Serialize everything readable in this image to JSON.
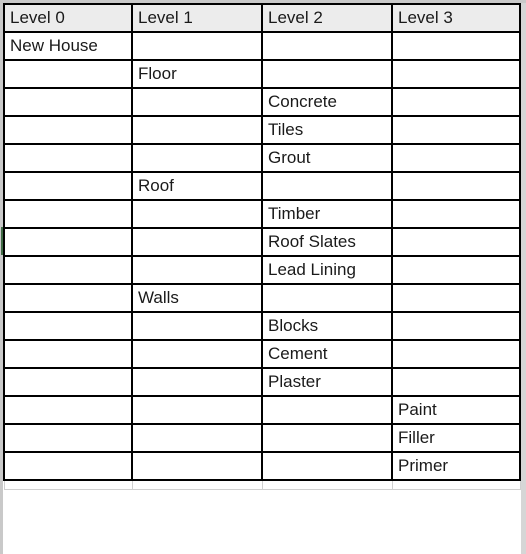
{
  "sheet": {
    "name": "work-breakdown-structure-sheet",
    "header_background": "#ececec",
    "grid_line_color": "#000000",
    "marker_color": "#3f6b45",
    "columns": [
      {
        "key": "level0",
        "label": "Level 0"
      },
      {
        "key": "level1",
        "label": "Level 1"
      },
      {
        "key": "level2",
        "label": "Level 2"
      },
      {
        "key": "level3",
        "label": "Level 3"
      }
    ],
    "rows": [
      {
        "level0": "New House",
        "level1": "",
        "level2": "",
        "level3": ""
      },
      {
        "level0": "",
        "level1": "Floor",
        "level2": "",
        "level3": ""
      },
      {
        "level0": "",
        "level1": "",
        "level2": "Concrete",
        "level3": ""
      },
      {
        "level0": "",
        "level1": "",
        "level2": "Tiles",
        "level3": ""
      },
      {
        "level0": "",
        "level1": "",
        "level2": "Grout",
        "level3": ""
      },
      {
        "level0": "",
        "level1": "Roof",
        "level2": "",
        "level3": ""
      },
      {
        "level0": "",
        "level1": "",
        "level2": "Timber",
        "level3": ""
      },
      {
        "level0": "",
        "level1": "",
        "level2": "Roof Slates",
        "level3": ""
      },
      {
        "level0": "",
        "level1": "",
        "level2": "Lead Lining",
        "level3": ""
      },
      {
        "level0": "",
        "level1": "Walls",
        "level2": "",
        "level3": ""
      },
      {
        "level0": "",
        "level1": "",
        "level2": "Blocks",
        "level3": ""
      },
      {
        "level0": "",
        "level1": "",
        "level2": "Cement",
        "level3": ""
      },
      {
        "level0": "",
        "level1": "",
        "level2": "Plaster",
        "level3": ""
      },
      {
        "level0": "",
        "level1": "",
        "level2": "",
        "level3": "Paint"
      },
      {
        "level0": "",
        "level1": "",
        "level2": "",
        "level3": "Filler"
      },
      {
        "level0": "",
        "level1": "",
        "level2": "",
        "level3": "Primer"
      }
    ],
    "marker_row_index": 7
  }
}
